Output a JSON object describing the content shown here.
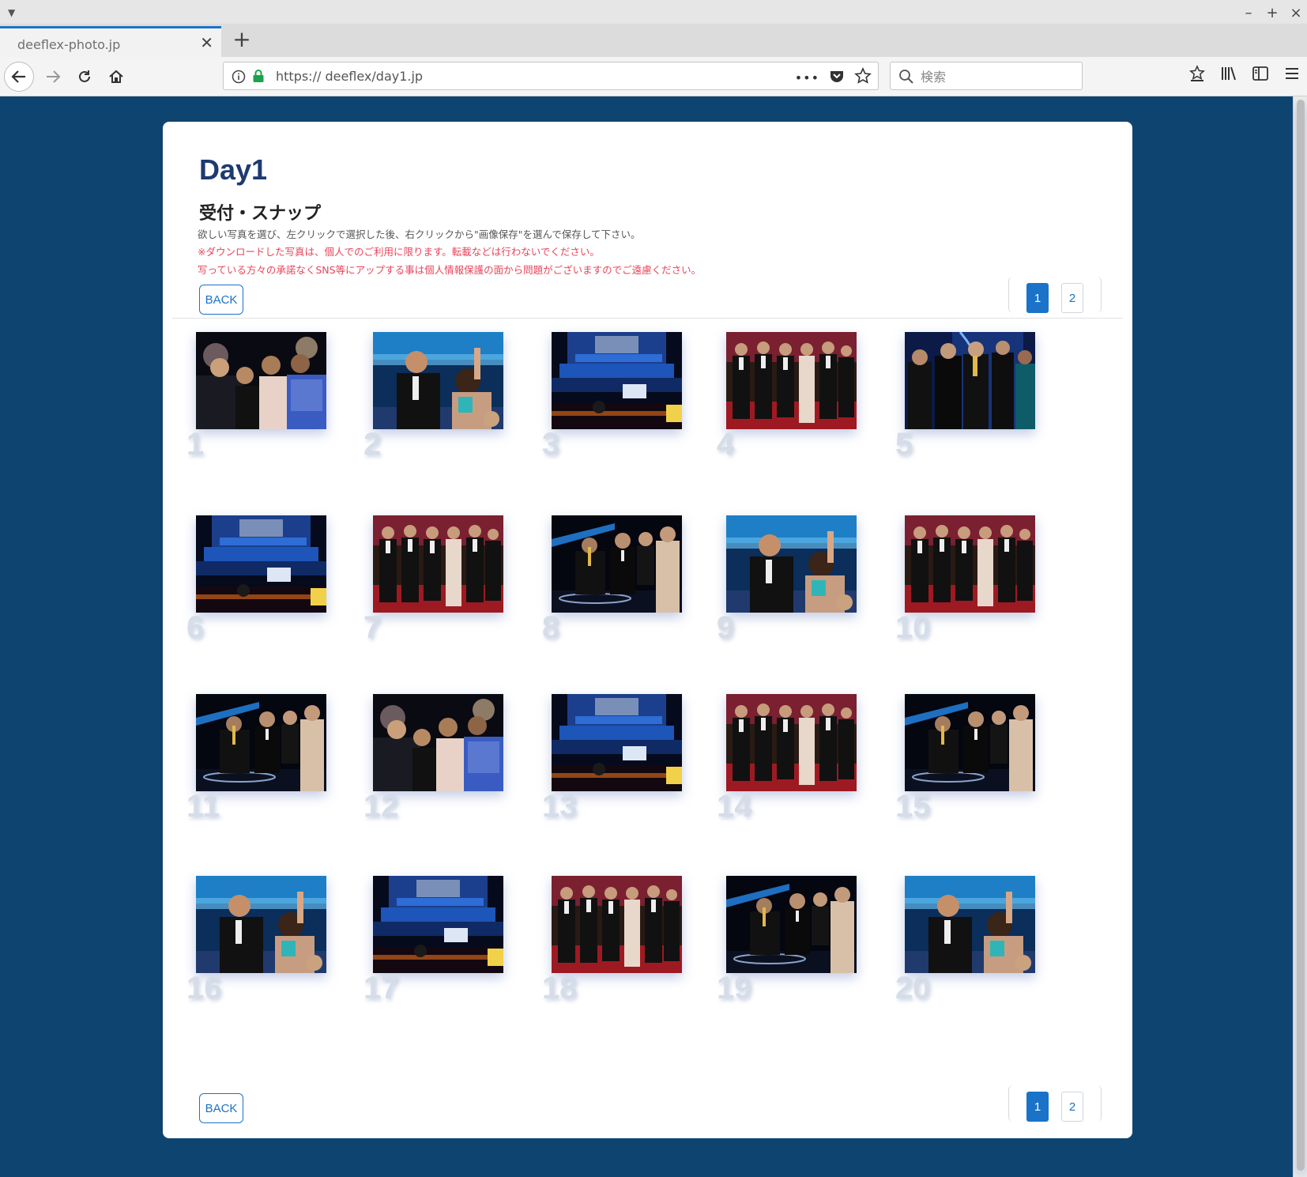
{
  "browser": {
    "tab_title": "deeflex-photo.jp",
    "url": "https:// deeflex/day1.jp",
    "search_placeholder": "検索",
    "url_more": "•••"
  },
  "page": {
    "title": "Day1",
    "section": "受付・スナップ",
    "instructions": "欲しい写真を選び、左クリックで選択した後、右クリックから\"画像保存\"を選んで保存して下さい。",
    "notice_1": "※ダウンロードした写真は、個人でのご利用に限ります。転載などは行わないでください。",
    "notice_2": "写っている方々の承諾なくSNS等にアップする事は個人情報保護の面から問題がございますのでご遠慮ください。",
    "back_label": "BACK",
    "pages": [
      "1",
      "2"
    ],
    "current_page": "1"
  },
  "photos": [
    {
      "number": "1",
      "scene": "group-selfie"
    },
    {
      "number": "2",
      "scene": "audience-wave"
    },
    {
      "number": "3",
      "scene": "stage"
    },
    {
      "number": "4",
      "scene": "red-carpet"
    },
    {
      "number": "5",
      "scene": "award-group"
    },
    {
      "number": "6",
      "scene": "stage"
    },
    {
      "number": "7",
      "scene": "red-carpet"
    },
    {
      "number": "8",
      "scene": "podium"
    },
    {
      "number": "9",
      "scene": "audience-wave"
    },
    {
      "number": "10",
      "scene": "red-carpet"
    },
    {
      "number": "11",
      "scene": "podium"
    },
    {
      "number": "12",
      "scene": "group-selfie"
    },
    {
      "number": "13",
      "scene": "stage"
    },
    {
      "number": "14",
      "scene": "red-carpet"
    },
    {
      "number": "15",
      "scene": "podium"
    },
    {
      "number": "16",
      "scene": "audience-wave"
    },
    {
      "number": "17",
      "scene": "stage"
    },
    {
      "number": "18",
      "scene": "red-carpet"
    },
    {
      "number": "19",
      "scene": "podium"
    },
    {
      "number": "20",
      "scene": "audience-wave"
    }
  ],
  "colors": {
    "background": "#0e4470",
    "accent": "#1a73c8",
    "title": "#1e3a70",
    "notice": "#e8445a",
    "number": "#d5dde9"
  }
}
